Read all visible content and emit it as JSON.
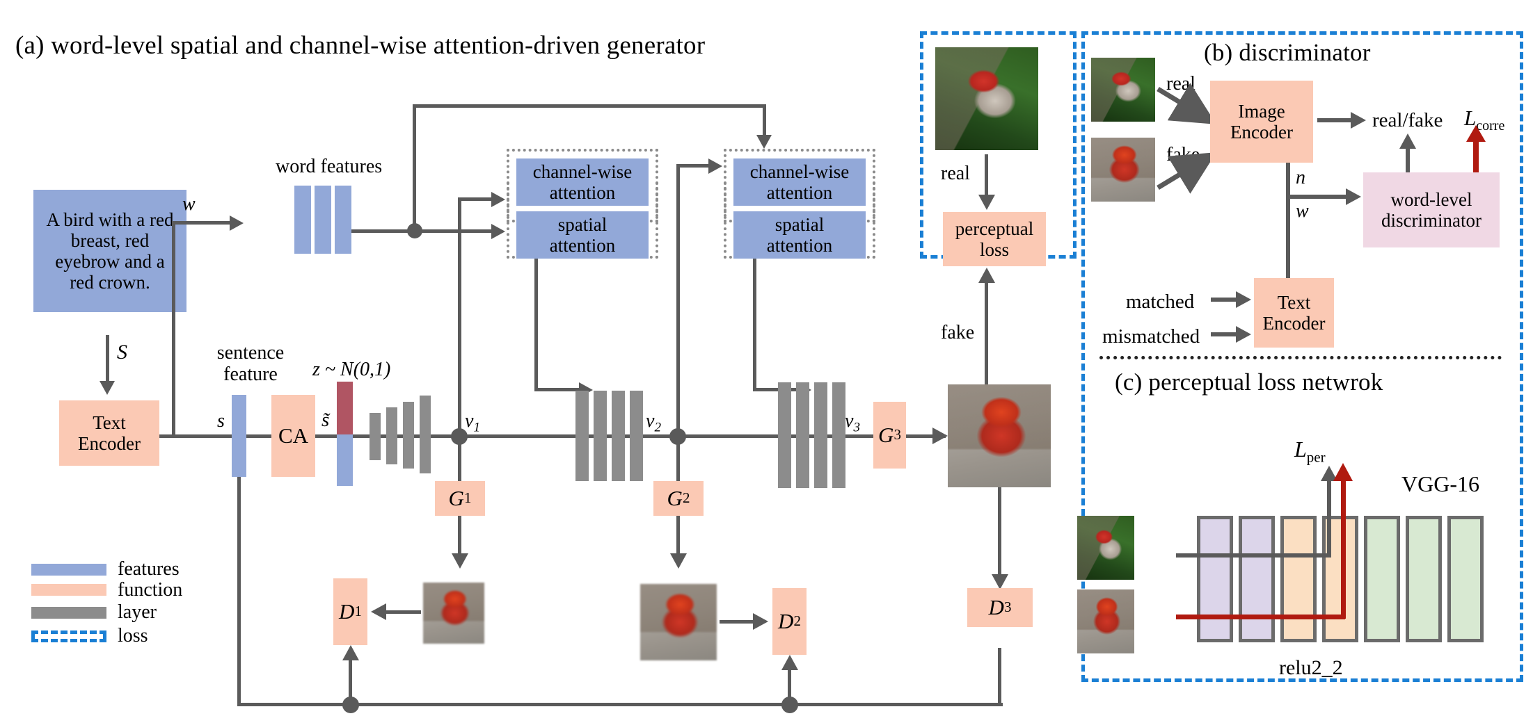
{
  "figure": {
    "panel_a_title": "(a) word-level spatial and channel-wise attention-driven generator",
    "panel_b_title": "(b) discriminator",
    "panel_c_title": "(c) perceptual loss netwrok"
  },
  "colors": {
    "features_blue": "#92a8d8",
    "function_peach": "#fbc9b4",
    "layer_gray": "#8c8c8c",
    "loss_dashed_blue": "#1a7fd4",
    "word_level_disc_pink": "#f0d8e4",
    "arrow_gray": "#5a5a5a",
    "arrow_red": "#b01a10",
    "noise_red": "#b05563",
    "vgg_block_purple": "#dcd5ea",
    "vgg_block_orange": "#fbdfc2",
    "vgg_block_green": "#d8e9d2"
  },
  "generator": {
    "caption_text": "A bird with a red breast, red eyebrow and a red crown.",
    "s_arrow_label": "S",
    "text_encoder_label": "Text\nEncoder",
    "text_encoder_line1": "Text",
    "text_encoder_line2": "Encoder",
    "sentence_feature_label": "sentence\nfeature",
    "sentence_feature_line1": "sentence",
    "sentence_feature_line2": "feature",
    "s_label": "s",
    "ca_label": "CA",
    "s_tilde_label": "s̃",
    "noise_label": "z ~ N(0,1)",
    "w_label": "w",
    "word_features_label": "word features",
    "attention_blocks": [
      {
        "channel": "channel-wise attention",
        "spatial": "spatial attention"
      },
      {
        "channel": "channel-wise attention",
        "spatial": "spatial attention"
      }
    ],
    "channel_attention_line1": "channel-wise",
    "channel_attention_line2": "attention",
    "spatial_attention_line1": "spatial",
    "spatial_attention_line2": "attention",
    "v_labels": [
      "v",
      "v",
      "v"
    ],
    "v_subscripts": [
      "1",
      "2",
      "3"
    ],
    "g_labels": [
      "G",
      "G",
      "G"
    ],
    "g_subscripts": [
      "1",
      "2",
      "3"
    ],
    "d_labels": [
      "D",
      "D",
      "D"
    ],
    "d_subscripts": [
      "1",
      "2",
      "3"
    ]
  },
  "legend": {
    "items": [
      {
        "swatch": "features-swatch",
        "label": "features"
      },
      {
        "swatch": "function-swatch",
        "label": "function"
      },
      {
        "swatch": "layer-swatch",
        "label": "layer"
      },
      {
        "swatch": "loss-swatch",
        "label": "loss"
      }
    ]
  },
  "perceptual_panel": {
    "real_label": "real",
    "fake_label": "fake",
    "perceptual_loss_line1": "perceptual",
    "perceptual_loss_line2": "loss"
  },
  "discriminator": {
    "real_label": "real",
    "fake_label": "fake",
    "image_encoder_line1": "Image",
    "image_encoder_line2": "Encoder",
    "real_fake_output": "real/fake",
    "l_corre_main": "L",
    "l_corre_sub": "corre",
    "n_label": "n",
    "w_label": "w",
    "word_level_disc_line1": "word-level",
    "word_level_disc_line2": "discriminator",
    "matched_label": "matched",
    "mismatched_label": "mismatched",
    "text_encoder_line1": "Text",
    "text_encoder_line2": "Encoder"
  },
  "perceptual_network": {
    "l_per_main": "L",
    "l_per_sub": "per",
    "vgg_label": "VGG-16",
    "relu_label": "relu2_2",
    "block_colors": [
      "#dcd5ea",
      "#dcd5ea",
      "#fbdfc2",
      "#fbdfc2",
      "#d8e9d2",
      "#d8e9d2",
      "#d8e9d2"
    ]
  }
}
